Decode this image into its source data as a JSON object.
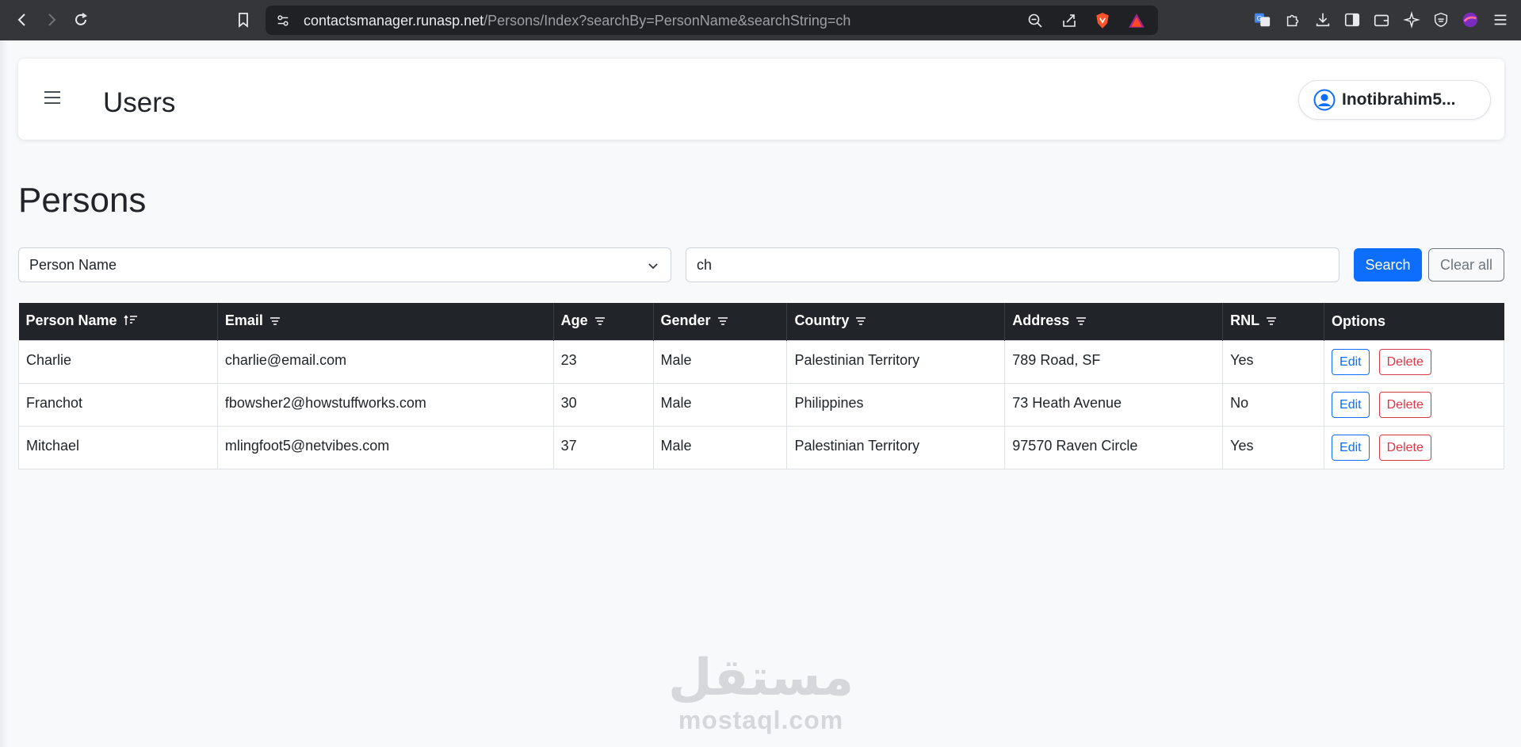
{
  "browser": {
    "url_host": "contactsmanager.runasp.net",
    "url_path": "/Persons/Index?searchBy=PersonName&searchString=ch"
  },
  "header": {
    "title": "Users",
    "user_name": "Inotibrahim5..."
  },
  "page": {
    "heading": "Persons"
  },
  "search": {
    "search_by": "Person Name",
    "search_string": "ch",
    "search_button": "Search",
    "clear_button": "Clear all"
  },
  "table": {
    "columns": [
      "Person Name",
      "Email",
      "Age",
      "Gender",
      "Country",
      "Address",
      "RNL",
      "Options"
    ],
    "rows": [
      {
        "name": "Charlie",
        "email": "charlie@email.com",
        "age": "23",
        "gender": "Male",
        "country": "Palestinian Territory",
        "address": "789 Road, SF",
        "rnl": "Yes"
      },
      {
        "name": "Franchot",
        "email": "fbowsher2@howstuffworks.com",
        "age": "30",
        "gender": "Male",
        "country": "Philippines",
        "address": "73 Heath Avenue",
        "rnl": "No"
      },
      {
        "name": "Mitchael",
        "email": "mlingfoot5@netvibes.com",
        "age": "37",
        "gender": "Male",
        "country": "Palestinian Territory",
        "address": "97570 Raven Circle",
        "rnl": "Yes"
      }
    ],
    "edit_label": "Edit",
    "delete_label": "Delete"
  },
  "watermark": {
    "arabic": "مستقل",
    "latin": "mostaql.com"
  },
  "colors": {
    "primary": "#0d6efd",
    "danger": "#dc3545",
    "table_header": "#212529",
    "page_bg": "#f8f9fa"
  }
}
